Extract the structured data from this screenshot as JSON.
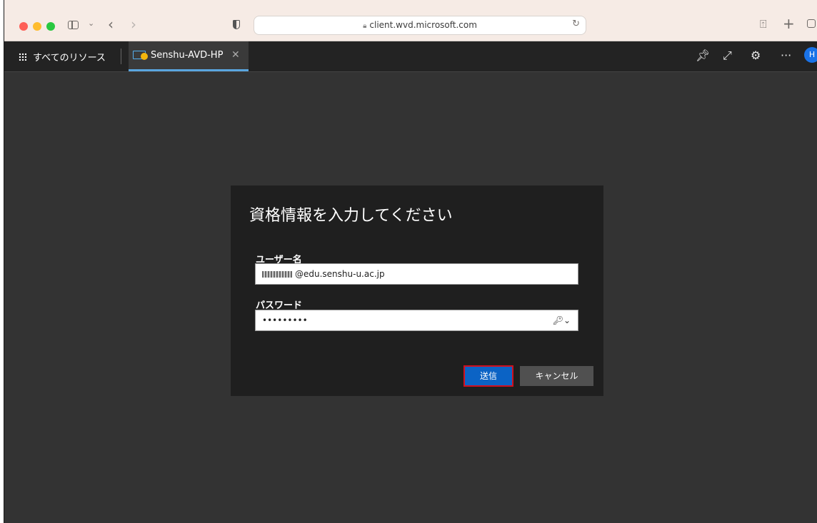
{
  "browser": {
    "url": "client.wvd.microsoft.com"
  },
  "app_bar": {
    "all_resources_label": "すべてのリソース",
    "tab_label": "Senshu-AVD-HP",
    "avatar_initial": "H"
  },
  "dialog": {
    "title": "資格情報を入力してください",
    "username_label": "ユーザー名",
    "username_value": "@edu.senshu-u.ac.jp",
    "password_label": "パスワード",
    "password_value": "•••••••••",
    "submit_label": "送信",
    "cancel_label": "キャンセル"
  },
  "colors": {
    "accent": "#0b63c5",
    "highlight_border": "#d20f1e",
    "tab_indicator": "#5aa6e0"
  }
}
